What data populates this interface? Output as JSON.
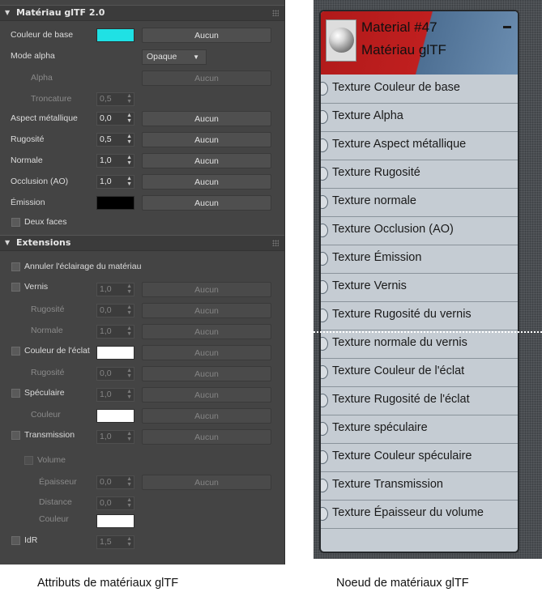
{
  "left_panel": {
    "gltf_rollout": {
      "title": "Matériau glTF 2.0",
      "base_color": {
        "label": "Couleur de base",
        "swatch": "#1fe1e4",
        "button": "Aucun"
      },
      "alpha_mode": {
        "label": "Mode alpha",
        "value": "Opaque"
      },
      "alpha": {
        "label": "Alpha",
        "button": "Aucun"
      },
      "cutoff": {
        "label": "Troncature",
        "value": "0,5"
      },
      "metallic": {
        "label": "Aspect métallique",
        "value": "0,0",
        "button": "Aucun"
      },
      "roughness": {
        "label": "Rugosité",
        "value": "0,5",
        "button": "Aucun"
      },
      "normal": {
        "label": "Normale",
        "value": "1,0",
        "button": "Aucun"
      },
      "occlusion": {
        "label": "Occlusion (AO)",
        "value": "1,0",
        "button": "Aucun"
      },
      "emission": {
        "label": "Émission",
        "swatch": "#000000",
        "button": "Aucun"
      },
      "double_sided": {
        "label": "Deux faces"
      }
    },
    "extensions_rollout": {
      "title": "Extensions",
      "unlit": {
        "label": "Annuler l'éclairage du matériau"
      },
      "clearcoat": {
        "label": "Vernis",
        "value": "1,0",
        "button": "Aucun"
      },
      "clearcoat_roughness": {
        "label": "Rugosité",
        "value": "0,0",
        "button": "Aucun"
      },
      "clearcoat_normal": {
        "label": "Normale",
        "value": "1,0",
        "button": "Aucun"
      },
      "sheen_color": {
        "label": "Couleur de l'éclat",
        "swatch": "#ffffff",
        "button": "Aucun"
      },
      "sheen_roughness": {
        "label": "Rugosité",
        "value": "0,0",
        "button": "Aucun"
      },
      "specular": {
        "label": "Spéculaire",
        "value": "1,0",
        "button": "Aucun"
      },
      "specular_color": {
        "label": "Couleur",
        "swatch": "#ffffff",
        "button": "Aucun"
      },
      "transmission": {
        "label": "Transmission",
        "value": "1,0",
        "button": "Aucun"
      },
      "volume": {
        "label": "Volume"
      },
      "thickness": {
        "label": "Épaisseur",
        "value": "0,0",
        "button": "Aucun"
      },
      "distance": {
        "label": "Distance",
        "value": "0,0"
      },
      "volume_color": {
        "label": "Couleur",
        "swatch": "#ffffff"
      },
      "ior": {
        "label": "IdR",
        "value": "1,5"
      }
    }
  },
  "node": {
    "name": "Material #47",
    "subtitle": "Matériau glTF",
    "slots": [
      "Texture Couleur de base",
      "Texture Alpha",
      "Texture Aspect métallique",
      "Texture Rugosité",
      "Texture normale",
      "Texture Occlusion (AO)",
      "Texture Émission",
      "Texture Vernis",
      "Texture Rugosité du vernis",
      "Texture normale du vernis",
      "Texture Couleur de l'éclat",
      "Texture Rugosité de l'éclat",
      "Texture spéculaire",
      "Texture Couleur spéculaire",
      "Texture Transmission",
      "Texture Épaisseur du volume"
    ]
  },
  "captions": {
    "left": "Attributs de matériaux glTF",
    "right": "Noeud de matériaux glTF"
  }
}
